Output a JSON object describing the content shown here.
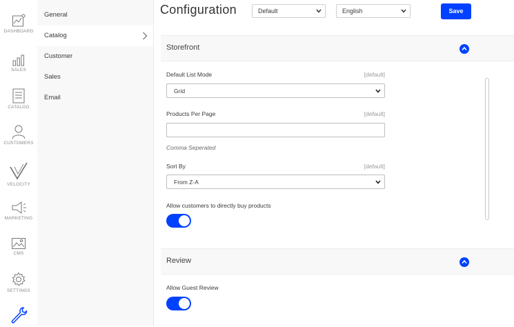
{
  "rail": {
    "items": [
      {
        "label": "DASHBOARD",
        "icon": "dashboard-icon"
      },
      {
        "label": "SALES",
        "icon": "sales-bar-chart-icon"
      },
      {
        "label": "CATALOG",
        "icon": "catalog-document-icon"
      },
      {
        "label": "CUSTOMERS",
        "icon": "customers-person-icon"
      },
      {
        "label": "VELOCITY",
        "icon": "velocity-checkmark-icon"
      },
      {
        "label": "MARKETING",
        "icon": "marketing-megaphone-icon"
      },
      {
        "label": "CMS",
        "icon": "cms-image-icon"
      },
      {
        "label": "SETTINGS",
        "icon": "settings-gear-icon"
      },
      {
        "label": "",
        "icon": "configuration-wrench-icon"
      }
    ]
  },
  "subnav": {
    "items": [
      {
        "label": "General"
      },
      {
        "label": "Catalog"
      },
      {
        "label": "Customer"
      },
      {
        "label": "Sales"
      },
      {
        "label": "Email"
      }
    ]
  },
  "header": {
    "title": "Configuration",
    "channel_select": "Default",
    "locale_select": "English",
    "save_label": "Save"
  },
  "storefront": {
    "title": "Storefront",
    "default_list_mode": {
      "label": "Default List Mode",
      "scope": "[default]",
      "value": "Grid"
    },
    "products_per_page": {
      "label": "Products Per Page",
      "scope": "[default]",
      "value": "",
      "hint": "Comma Seperated"
    },
    "sort_by": {
      "label": "Sort By",
      "scope": "[default]",
      "value": "From Z-A"
    },
    "buy_now": {
      "label": "Allow customers to directly buy products",
      "enabled": true
    }
  },
  "review": {
    "title": "Review",
    "guest_review": {
      "label": "Allow Guest Review",
      "enabled": true
    }
  },
  "colors": {
    "accent": "#0041ff",
    "panel": "#f8f8f8"
  }
}
